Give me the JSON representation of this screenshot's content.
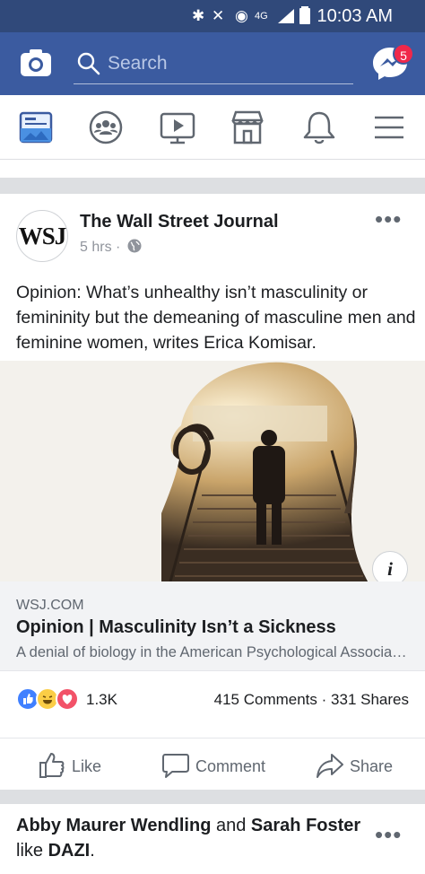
{
  "status_bar": {
    "time": "10:03 AM",
    "network": "4G"
  },
  "top_bar": {
    "search_placeholder": "Search",
    "messenger_badge": "5",
    "accent_color": "#3b5ba0"
  },
  "nav": {
    "items": [
      "news-feed",
      "groups",
      "watch",
      "marketplace",
      "notifications",
      "menu"
    ]
  },
  "post": {
    "page_name": "The Wall Street Journal",
    "avatar_text": "WSJ",
    "time": "5 hrs",
    "separator": "·",
    "text": "Opinion: What’s unhealthy isn’t masculinity or femininity but the demeaning of masculine men and feminine women, writes Erica Komisar.",
    "link": {
      "domain": "WSJ.COM",
      "title": "Opinion | Masculinity Isn’t a Sickness",
      "description": "A denial of biology in the American Psychological Association..."
    },
    "info_label": "i",
    "reaction_count": "1.3K",
    "comments": "415 Comments",
    "dot": "·",
    "shares": "331 Shares",
    "actions": {
      "like": "Like",
      "comment": "Comment",
      "share": "Share"
    }
  },
  "next_story": {
    "person1": "Abby Maurer Wendling",
    "connector": "and",
    "person2": "Sarah Foster",
    "verb": "like",
    "page": "DAZI",
    "end": "."
  }
}
